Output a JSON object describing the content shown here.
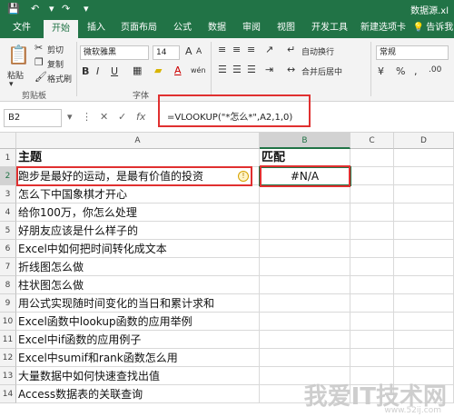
{
  "titlebar": {
    "doc_title": "数据源.xl"
  },
  "tabs": [
    "文件",
    "开始",
    "插入",
    "页面布局",
    "公式",
    "数据",
    "审阅",
    "视图",
    "开发工具",
    "新建选项卡",
    "告诉我"
  ],
  "ribbon": {
    "cut": "剪切",
    "copy": "复制",
    "paste": "粘贴",
    "format_painter": "格式刷",
    "clipboard_group": "剪贴板",
    "font_name": "微软雅黑",
    "font_size": "14",
    "font_group": "字体",
    "wrap_text": "自动换行",
    "merge_center": "合并后居中",
    "number_format": "常规",
    "bold": "B",
    "italic": "I",
    "underline": "U",
    "grow_font": "A",
    "shrink_font": "A",
    "font_color_letter": "A",
    "wen_glyph": "wén"
  },
  "formula_bar": {
    "name_box": "B2",
    "formula": "=VLOOKUP(\"*怎么*\",A2,1,0)"
  },
  "columns": [
    "A",
    "B",
    "C",
    "D"
  ],
  "rows": [
    "1",
    "2",
    "3",
    "4",
    "5",
    "6",
    "7",
    "8",
    "9",
    "10",
    "11",
    "12",
    "13",
    "14"
  ],
  "cells": {
    "A1": "主题",
    "B1": "匹配",
    "B2": "#N/A",
    "A": [
      "主题",
      "跑步是最好的运动，是最有价值的投资",
      "怎么下中国象棋才开心",
      "给你100万，你怎么处理",
      "好朋友应该是什么样子的",
      "Excel中如何把时间转化成文本",
      "折线图怎么做",
      "柱状图怎么做",
      "用公式实现随时间变化的当日和累计求和",
      "Excel函数中lookup函数的应用举例",
      "Excel中if函数的应用例子",
      "Excel中sumif和rank函数怎么用",
      "大量数据中如何快速查找出值",
      "Access数据表的关联查询"
    ]
  },
  "watermark": {
    "main": "我爱IT技术网",
    "sub": "www.52ij.com"
  },
  "colors": {
    "excel_green": "#217346",
    "highlight_red": "#e03030"
  }
}
